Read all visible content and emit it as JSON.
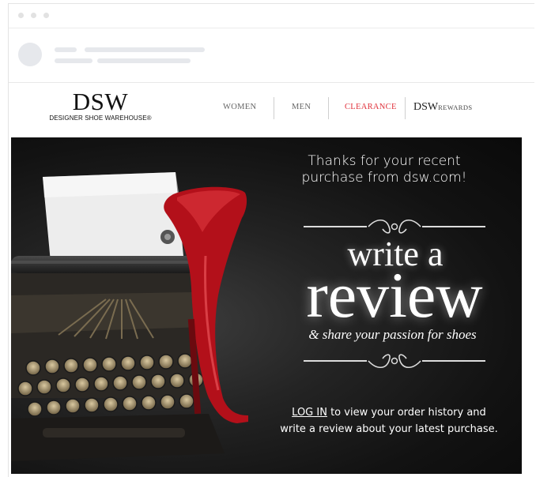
{
  "email": {
    "brand": {
      "logo_main": "DSW",
      "logo_sub": "DESIGNER SHOE WAREHOUSE®"
    },
    "nav": {
      "women": "WOMEN",
      "men": "MEN",
      "clearance": "CLEARANCE",
      "rewards_dsw": "DSW",
      "rewards_label": "REWARDS"
    },
    "hero": {
      "thanks_line1": "Thanks for your recent",
      "thanks_line2": "purchase from dsw.com!",
      "headline_write": "write a",
      "headline_review": "review",
      "tagline": "& share your passion for shoes",
      "login_link": "LOG IN",
      "login_rest": " to view your order history and",
      "login_line2": "write a review about your latest purchase."
    }
  },
  "colors": {
    "clearance": "#e0323c",
    "shoe_red": "#c8121c",
    "hero_bg": "#111111"
  },
  "icons": [
    "window-dot-icon",
    "avatar-icon",
    "typewriter-illustration",
    "red-heel-shoe-illustration",
    "ornament-divider-icon"
  ]
}
